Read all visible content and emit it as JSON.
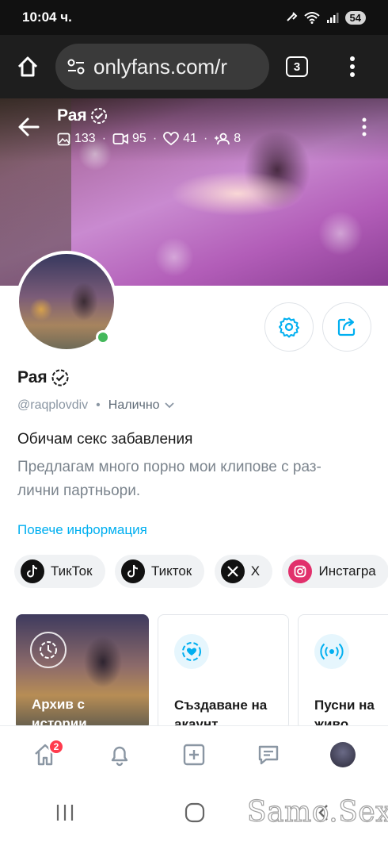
{
  "status_bar": {
    "time": "10:04 ч.",
    "battery": "54"
  },
  "browser": {
    "url": "onlyfans.com/r",
    "tab_count": "3"
  },
  "cover": {
    "name": "Рая",
    "stats": {
      "photos": "133",
      "videos": "95",
      "likes": "41",
      "fans": "8"
    }
  },
  "profile": {
    "name": "Рая",
    "handle": "@raqplovdiv",
    "separator": "•",
    "availability": "Налично",
    "bio_title": "Обичам секс забавления",
    "bio_body": "Предлагам много порно мои клипове с раз-\nлични партньори.",
    "more_info": "Повече информация"
  },
  "social_links": [
    {
      "label": "ТикТок",
      "icon": "tiktok-icon",
      "color": "#111111"
    },
    {
      "label": "Тикток",
      "icon": "tiktok-icon",
      "color": "#111111"
    },
    {
      "label": "X",
      "icon": "x-icon",
      "color": "#111111"
    },
    {
      "label": "Инстагра",
      "icon": "instagram-icon",
      "color": "#e1306c"
    }
  ],
  "cards": {
    "archive": "Архив с\nистории",
    "create_account": "Създаване на\nакаунт",
    "go_live": "Пусни на\nживо"
  },
  "bottom_nav": {
    "notifications_badge": "2"
  },
  "watermark": "Samo.Sex",
  "colors": {
    "accent": "#00aff0",
    "online": "#44b85b",
    "badge": "#ff3b4d"
  }
}
